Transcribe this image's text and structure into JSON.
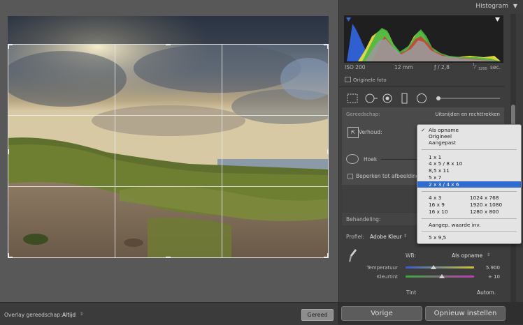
{
  "histogram": {
    "title": "Histogram",
    "toggle_icon": "triangle-down-icon",
    "exif": {
      "iso": "ISO 200",
      "focal": "12 mm",
      "aperture": "ƒ / 2,8",
      "shutter_num": "1",
      "shutter_den": "3200",
      "shutter_unit": "sec."
    },
    "original_photo_label": "Originele foto",
    "colors": {
      "blue": "#2f5fd0",
      "yellow": "#e8df3a",
      "green": "#46b843",
      "red": "#d23a3a",
      "gray": "#9a9a9a",
      "magenta": "#c03ab8"
    }
  },
  "tool_strip": {
    "icons": [
      "crop-overlay-icon",
      "spot-removal-icon",
      "red-eye-icon",
      "graduated-filter-icon",
      "radial-filter-icon",
      "adjustment-brush-icon"
    ]
  },
  "crop_panel": {
    "tool_label": "Gereedschap:",
    "tool_value": "Uitsnijden en rechttrekken",
    "aspect_label": "Verhoud:",
    "angle_label": "Hoek",
    "constrain_label": "Beperken tot afbeelding"
  },
  "treatment": {
    "label": "Behandeling:"
  },
  "profile": {
    "label": "Profiel:",
    "value": "Adobe Kleur"
  },
  "white_balance": {
    "label": "WB:",
    "value": "Als opname",
    "temperature": {
      "label": "Temperatuur",
      "value": "5.900"
    },
    "tint": {
      "label": "Kleurtint",
      "value": "+ 10"
    }
  },
  "tone": {
    "label": "Tint",
    "auto_label": "Autom."
  },
  "left_toolbar": {
    "overlay_label": "Overlay gereedschap:",
    "overlay_value": "Altijd",
    "done_label": "Gereed"
  },
  "right_buttons": {
    "previous": "Vorige",
    "reset": "Opnieuw instellen"
  },
  "aspect_menu": {
    "checked_item": "✓",
    "groups": [
      [
        "Als opname",
        "Origineel",
        "Aangepast"
      ],
      [
        "1 x 1",
        "4 x 5 / 8 x 10",
        "8,5 x 11",
        "5 x 7",
        "2 x 3 / 4 x 6"
      ],
      [
        [
          "4 x 3",
          "1024 x 768"
        ],
        [
          "16 x 9",
          "1920 x 1080"
        ],
        [
          "16 x 10",
          "1280 x 800"
        ]
      ],
      [
        "Aangep. waarde inv."
      ],
      [
        "5 x 9,5"
      ]
    ],
    "selected": "2 x 3 / 4 x 6"
  }
}
